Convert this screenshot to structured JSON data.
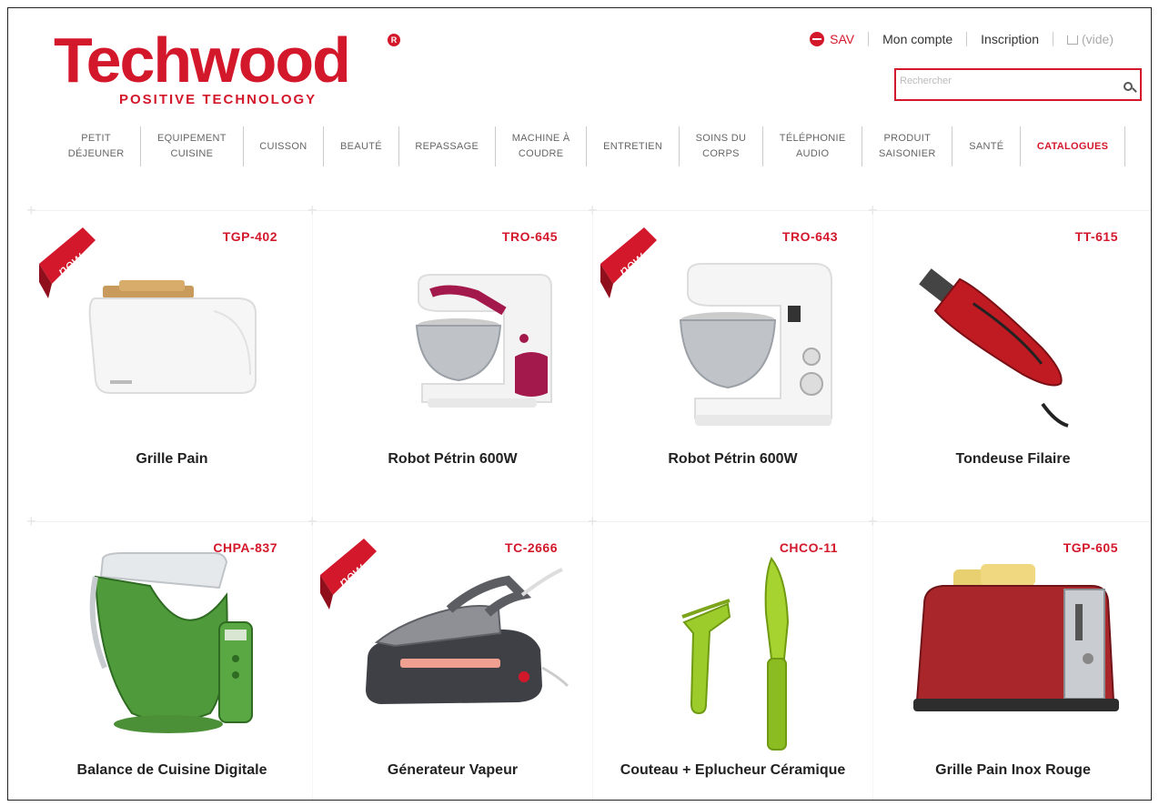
{
  "header": {
    "logo_text": "Techwood",
    "logo_reg": "R",
    "tagline": "POSITIVE TECHNOLOGY",
    "links": {
      "sav": "SAV",
      "account": "Mon compte",
      "signup": "Inscription",
      "cart": "(vide)"
    },
    "search_placeholder": "Rechercher"
  },
  "nav": [
    "PETIT\nDÉJEUNER",
    "EQUIPEMENT\nCUISINE",
    "CUISSON",
    "BEAUTÉ",
    "REPASSAGE",
    "MACHINE À\nCOUDRE",
    "ENTRETIEN",
    "SOINS DU\nCORPS",
    "TÉLÉPHONIE\nAUDIO",
    "PRODUIT\nSAISONIER",
    "SANTÉ",
    "CATALOGUES"
  ],
  "products": [
    {
      "code": "TGP-402",
      "name": "Grille Pain",
      "badge": "new",
      "icon": "toaster-icon"
    },
    {
      "code": "TRO-645",
      "name": "Robot Pétrin 600W",
      "badge": "",
      "icon": "stand-mixer-icon"
    },
    {
      "code": "TRO-643",
      "name": "Robot Pétrin 600W",
      "badge": "new",
      "icon": "stand-mixer-icon"
    },
    {
      "code": "TT-615",
      "name": "Tondeuse Filaire",
      "badge": "",
      "icon": "hair-clipper-icon"
    },
    {
      "code": "CHPA-837",
      "name": "Balance de Cuisine Digitale",
      "badge": "",
      "icon": "kitchen-scale-icon"
    },
    {
      "code": "TC-2666",
      "name": "Génerateur Vapeur",
      "badge": "new",
      "icon": "steam-iron-icon"
    },
    {
      "code": "CHCO-11",
      "name": "Couteau + Eplucheur Céramique",
      "badge": "",
      "icon": "knife-peeler-icon"
    },
    {
      "code": "TGP-605",
      "name": "Grille Pain Inox Rouge",
      "badge": "",
      "icon": "red-toaster-icon"
    }
  ],
  "colors": {
    "brand": "#d3182b"
  }
}
